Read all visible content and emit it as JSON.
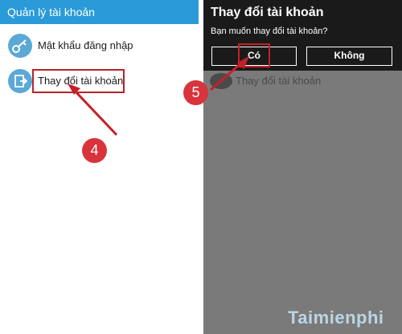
{
  "left_panel": {
    "header_title": "Quản lý tài khoản",
    "items": [
      {
        "label": "Mật khẩu đăng nhập",
        "icon": "key-icon"
      },
      {
        "label": "Thay đổi tài khoản",
        "icon": "account-switch-icon"
      }
    ]
  },
  "dialog": {
    "title": "Thay đổi tài khoản",
    "message": "Bạn muốn thay đổi tài khoản?",
    "yes_label": "Có",
    "no_label": "Không"
  },
  "background_item": {
    "label": "Thay đổi tài khoản"
  },
  "steps": {
    "step4": "4",
    "step5": "5"
  },
  "watermark": "Taimienphi",
  "colors": {
    "header_blue": "#2a9bd8",
    "icon_blue": "#5aa9d6",
    "highlight_red": "#b8232a",
    "badge_red": "#d9333c",
    "dialog_bg": "#1a1a1a",
    "overlay_gray": "#7a7a7a"
  }
}
